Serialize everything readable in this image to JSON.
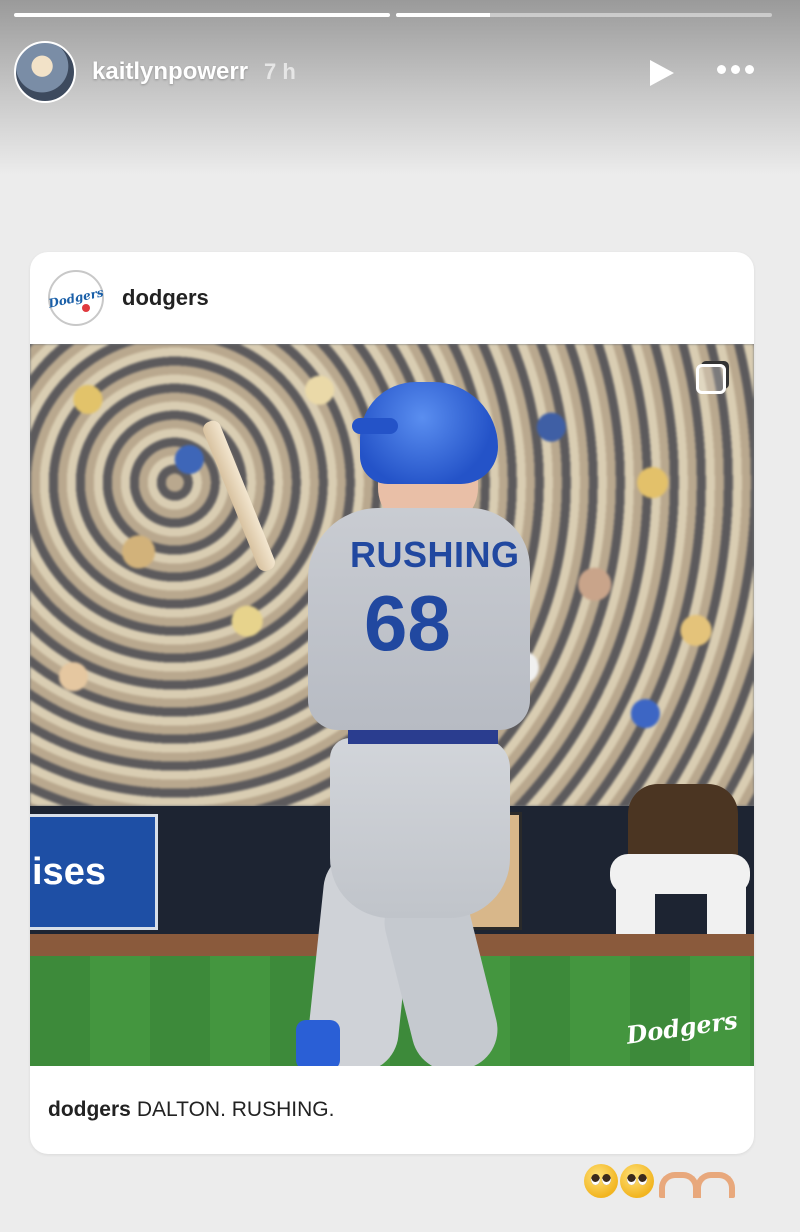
{
  "story": {
    "progress": [
      1.0,
      0.25
    ],
    "username": "kaitlynpowerr",
    "time": "7 h"
  },
  "post": {
    "username": "dodgers",
    "logo_text": "Dodgers",
    "jersey_name": "RUSHING",
    "jersey_number": "68",
    "banner_text": "ises",
    "watermark": "Dodgers",
    "caption_user": "dodgers",
    "caption_text": "DALTON. RUSHING."
  },
  "reactions": [
    "pleading-face",
    "pleading-face",
    "heart-hands",
    "heart-hands"
  ],
  "colors": {
    "dodger_blue": "#2148a0",
    "helmet_blue": "#2453c8"
  }
}
